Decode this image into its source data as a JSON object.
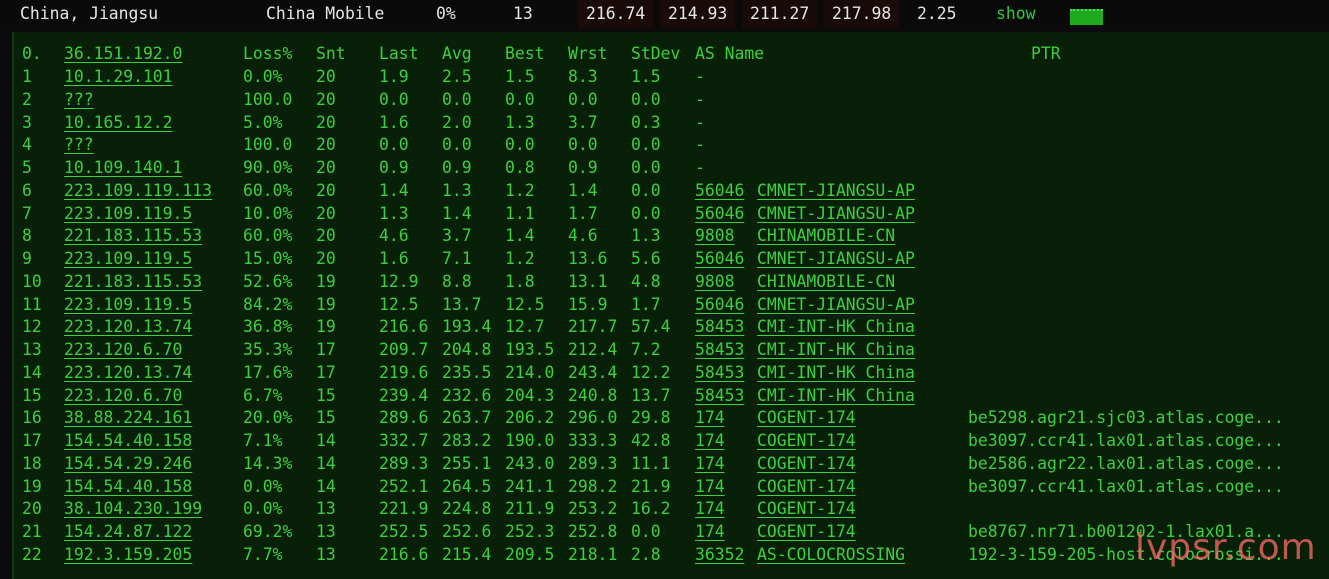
{
  "topbar": {
    "location": "China, Jiangsu",
    "isp": "China Mobile",
    "loss": "0%",
    "snt": "13",
    "last": "216.74",
    "avg": "214.93",
    "best": "211.27",
    "worst": "217.98",
    "stdev": "2.25",
    "show_label": "show",
    "colors": {
      "dark_cell": "#1a0b0b",
      "bar": "#1fa91f"
    }
  },
  "table": {
    "headers": {
      "hop": "0.",
      "host": "36.151.192.0",
      "loss": "Loss%",
      "snt": "Snt",
      "last": "Last",
      "avg": "Avg",
      "best": "Best",
      "wrst": "Wrst",
      "stdev": "StDev",
      "as_name": "AS Name",
      "ptr": "PTR"
    },
    "rows": [
      {
        "hop": "1",
        "host": "10.1.29.101",
        "loss": "0.0%",
        "snt": "20",
        "last": "1.9",
        "avg": "2.5",
        "best": "1.5",
        "wrst": "8.3",
        "stdev": "1.5",
        "asn": "-",
        "as_name": "",
        "ptr": ""
      },
      {
        "hop": "2",
        "host": "???",
        "loss": "100.0",
        "snt": "20",
        "last": "0.0",
        "avg": "0.0",
        "best": "0.0",
        "wrst": "0.0",
        "stdev": "0.0",
        "asn": "-",
        "as_name": "",
        "ptr": ""
      },
      {
        "hop": "3",
        "host": "10.165.12.2",
        "loss": "5.0%",
        "snt": "20",
        "last": "1.6",
        "avg": "2.0",
        "best": "1.3",
        "wrst": "3.7",
        "stdev": "0.3",
        "asn": "-",
        "as_name": "",
        "ptr": ""
      },
      {
        "hop": "4",
        "host": "???",
        "loss": "100.0",
        "snt": "20",
        "last": "0.0",
        "avg": "0.0",
        "best": "0.0",
        "wrst": "0.0",
        "stdev": "0.0",
        "asn": "-",
        "as_name": "",
        "ptr": ""
      },
      {
        "hop": "5",
        "host": "10.109.140.1",
        "loss": "90.0%",
        "snt": "20",
        "last": "0.9",
        "avg": "0.9",
        "best": "0.8",
        "wrst": "0.9",
        "stdev": "0.0",
        "asn": "-",
        "as_name": "",
        "ptr": ""
      },
      {
        "hop": "6",
        "host": "223.109.119.113",
        "loss": "60.0%",
        "snt": "20",
        "last": "1.4",
        "avg": "1.3",
        "best": "1.2",
        "wrst": "1.4",
        "stdev": "0.0",
        "asn": "56046",
        "as_name": "CMNET-JIANGSU-AP",
        "ptr": ""
      },
      {
        "hop": "7",
        "host": "223.109.119.5",
        "loss": "10.0%",
        "snt": "20",
        "last": "1.3",
        "avg": "1.4",
        "best": "1.1",
        "wrst": "1.7",
        "stdev": "0.0",
        "asn": "56046",
        "as_name": "CMNET-JIANGSU-AP",
        "ptr": ""
      },
      {
        "hop": "8",
        "host": "221.183.115.53",
        "loss": "60.0%",
        "snt": "20",
        "last": "4.6",
        "avg": "3.7",
        "best": "1.4",
        "wrst": "4.6",
        "stdev": "1.3",
        "asn": "9808",
        "as_name": "CHINAMOBILE-CN",
        "ptr": ""
      },
      {
        "hop": "9",
        "host": "223.109.119.5",
        "loss": "15.0%",
        "snt": "20",
        "last": "1.6",
        "avg": "7.1",
        "best": "1.2",
        "wrst": "13.6",
        "stdev": "5.6",
        "asn": "56046",
        "as_name": "CMNET-JIANGSU-AP",
        "ptr": ""
      },
      {
        "hop": "10",
        "host": "221.183.115.53",
        "loss": "52.6%",
        "snt": "19",
        "last": "12.9",
        "avg": "8.8",
        "best": "1.8",
        "wrst": "13.1",
        "stdev": "4.8",
        "asn": "9808",
        "as_name": "CHINAMOBILE-CN",
        "ptr": ""
      },
      {
        "hop": "11",
        "host": "223.109.119.5",
        "loss": "84.2%",
        "snt": "19",
        "last": "12.5",
        "avg": "13.7",
        "best": "12.5",
        "wrst": "15.9",
        "stdev": "1.7",
        "asn": "56046",
        "as_name": "CMNET-JIANGSU-AP",
        "ptr": ""
      },
      {
        "hop": "12",
        "host": "223.120.13.74",
        "loss": "36.8%",
        "snt": "19",
        "last": "216.6",
        "avg": "193.4",
        "best": "12.7",
        "wrst": "217.7",
        "stdev": "57.4",
        "asn": "58453",
        "as_name": "CMI-INT-HK China",
        "ptr": ""
      },
      {
        "hop": "13",
        "host": "223.120.6.70",
        "loss": "35.3%",
        "snt": "17",
        "last": "209.7",
        "avg": "204.8",
        "best": "193.5",
        "wrst": "212.4",
        "stdev": "7.2",
        "asn": "58453",
        "as_name": "CMI-INT-HK China",
        "ptr": ""
      },
      {
        "hop": "14",
        "host": "223.120.13.74",
        "loss": "17.6%",
        "snt": "17",
        "last": "219.6",
        "avg": "235.5",
        "best": "214.0",
        "wrst": "243.4",
        "stdev": "12.2",
        "asn": "58453",
        "as_name": "CMI-INT-HK China",
        "ptr": ""
      },
      {
        "hop": "15",
        "host": "223.120.6.70",
        "loss": "6.7%",
        "snt": "15",
        "last": "239.4",
        "avg": "232.6",
        "best": "204.3",
        "wrst": "240.8",
        "stdev": "13.7",
        "asn": "58453",
        "as_name": "CMI-INT-HK China",
        "ptr": ""
      },
      {
        "hop": "16",
        "host": "38.88.224.161",
        "loss": "20.0%",
        "snt": "15",
        "last": "289.6",
        "avg": "263.7",
        "best": "206.2",
        "wrst": "296.0",
        "stdev": "29.8",
        "asn": "174",
        "as_name": "COGENT-174",
        "ptr": "be5298.agr21.sjc03.atlas.coge..."
      },
      {
        "hop": "17",
        "host": "154.54.40.158",
        "loss": "7.1%",
        "snt": "14",
        "last": "332.7",
        "avg": "283.2",
        "best": "190.0",
        "wrst": "333.3",
        "stdev": "42.8",
        "asn": "174",
        "as_name": "COGENT-174",
        "ptr": "be3097.ccr41.lax01.atlas.coge..."
      },
      {
        "hop": "18",
        "host": "154.54.29.246",
        "loss": "14.3%",
        "snt": "14",
        "last": "289.3",
        "avg": "255.1",
        "best": "243.0",
        "wrst": "289.3",
        "stdev": "11.1",
        "asn": "174",
        "as_name": "COGENT-174",
        "ptr": "be2586.agr22.lax01.atlas.coge..."
      },
      {
        "hop": "19",
        "host": "154.54.40.158",
        "loss": "0.0%",
        "snt": "14",
        "last": "252.1",
        "avg": "264.5",
        "best": "241.1",
        "wrst": "298.2",
        "stdev": "21.9",
        "asn": "174",
        "as_name": "COGENT-174",
        "ptr": "be3097.ccr41.lax01.atlas.coge..."
      },
      {
        "hop": "20",
        "host": "38.104.230.199",
        "loss": "0.0%",
        "snt": "13",
        "last": "221.9",
        "avg": "224.8",
        "best": "211.9",
        "wrst": "253.2",
        "stdev": "16.2",
        "asn": "174",
        "as_name": "COGENT-174",
        "ptr": ""
      },
      {
        "hop": "21",
        "host": "154.24.87.122",
        "loss": "69.2%",
        "snt": "13",
        "last": "252.5",
        "avg": "252.6",
        "best": "252.3",
        "wrst": "252.8",
        "stdev": "0.0",
        "asn": "174",
        "as_name": "COGENT-174",
        "ptr": "be8767.nr71.b001202-1.lax01.a..."
      },
      {
        "hop": "22",
        "host": "192.3.159.205",
        "loss": "7.7%",
        "snt": "13",
        "last": "216.6",
        "avg": "215.4",
        "best": "209.5",
        "wrst": "218.1",
        "stdev": "2.8",
        "asn": "36352",
        "as_name": "AS-COLOCROSSING",
        "ptr": "192-3-159-205-host.colocrossi..."
      }
    ]
  },
  "watermark": "lvpsr.com"
}
